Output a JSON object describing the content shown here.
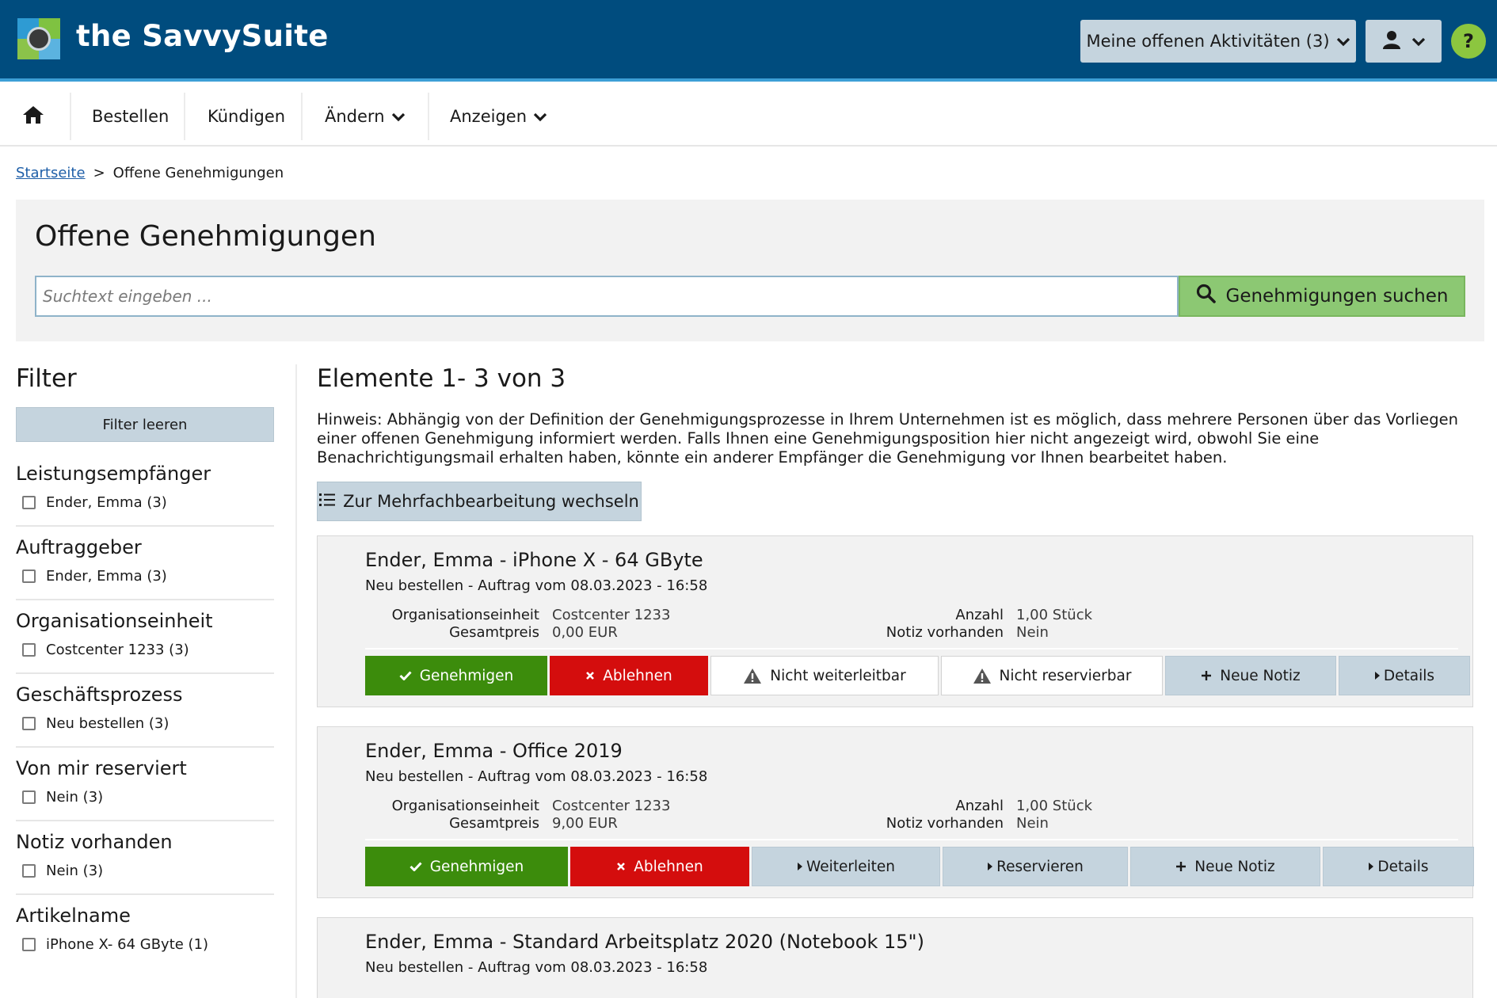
{
  "header": {
    "brand": "the SavvySuite",
    "activities_label": "Meine offenen Aktivitäten (3)",
    "help_label": "?"
  },
  "nav": {
    "order": "Bestellen",
    "cancel": "Kündigen",
    "change": "Ändern",
    "show": "Anzeigen"
  },
  "breadcrumb": {
    "home": "Startseite",
    "separator": ">",
    "current": "Offene Genehmigungen"
  },
  "search": {
    "title": "Offene Genehmigungen",
    "placeholder": "Suchtext eingeben ...",
    "button_label": "Genehmigungen suchen"
  },
  "filter": {
    "title": "Filter",
    "clear_label": "Filter leeren",
    "groups": [
      {
        "title": "Leistungsempfänger",
        "options": [
          "Ender, Emma (3)"
        ]
      },
      {
        "title": "Auftraggeber",
        "options": [
          "Ender, Emma (3)"
        ]
      },
      {
        "title": "Organisationseinheit",
        "options": [
          "Costcenter 1233 (3)"
        ]
      },
      {
        "title": "Geschäftsprozess",
        "options": [
          "Neu bestellen (3)"
        ]
      },
      {
        "title": "Von mir reserviert",
        "options": [
          "Nein (3)"
        ]
      },
      {
        "title": "Notiz vorhanden",
        "options": [
          "Nein (3)"
        ]
      },
      {
        "title": "Artikelname",
        "options": [
          "iPhone X- 64 GByte (1)"
        ]
      }
    ]
  },
  "list": {
    "count_title": "Elemente 1- 3 von 3",
    "hint": "Hinweis: Abhängig von der Definition der Genehmigungsprozesse in Ihrem Unternehmen ist es möglich, dass mehrere Personen über das Vorliegen einer offenen Genehmigung informiert werden. Falls Ihnen eine Genehmigungsposition hier nicht angezeigt wird, obwohl Sie eine Benachrichtigungsmail erhalten haben, könnte ein anderer Empfänger die Genehmigung vor Ihnen bearbeitet haben.",
    "bulk_label": "Zur Mehrfachbearbeitung wechseln",
    "labels": {
      "org_unit": "Organisationseinheit",
      "total_price": "Gesamtpreis",
      "quantity": "Anzahl",
      "note": "Notiz vorhanden"
    },
    "items": [
      {
        "title": "Ender, Emma - iPhone X - 64 GByte",
        "subtitle": "Neu bestellen - Auftrag vom 08.03.2023 - 16:58",
        "org_unit": "Costcenter 1233",
        "total_price": "0,00 EUR",
        "quantity": "1,00 Stück",
        "note": "Nein",
        "actions": {
          "approve": "Genehmigen",
          "reject": "Ablehnen",
          "forward": "Nicht weiterleitbar",
          "reserve": "Nicht reservierbar",
          "new_note": "Neue Notiz",
          "details": "Details"
        }
      },
      {
        "title": "Ender, Emma - Office 2019",
        "subtitle": "Neu bestellen - Auftrag vom 08.03.2023 - 16:58",
        "org_unit": "Costcenter 1233",
        "total_price": "9,00 EUR",
        "quantity": "1,00 Stück",
        "note": "Nein",
        "actions": {
          "approve": "Genehmigen",
          "reject": "Ablehnen",
          "forward": "Weiterleiten",
          "reserve": "Reservieren",
          "new_note": "Neue Notiz",
          "details": "Details"
        }
      },
      {
        "title": "Ender, Emma - Standard Arbeitsplatz 2020 (Notebook 15\")",
        "subtitle": "Neu bestellen - Auftrag vom 08.03.2023 - 16:58"
      }
    ]
  },
  "colors": {
    "header_bg": "#004c7e",
    "approve": "#3c8c0c",
    "reject": "#d40d0d",
    "search_button": "#8cc873",
    "secondary_button": "#c5d4de"
  }
}
